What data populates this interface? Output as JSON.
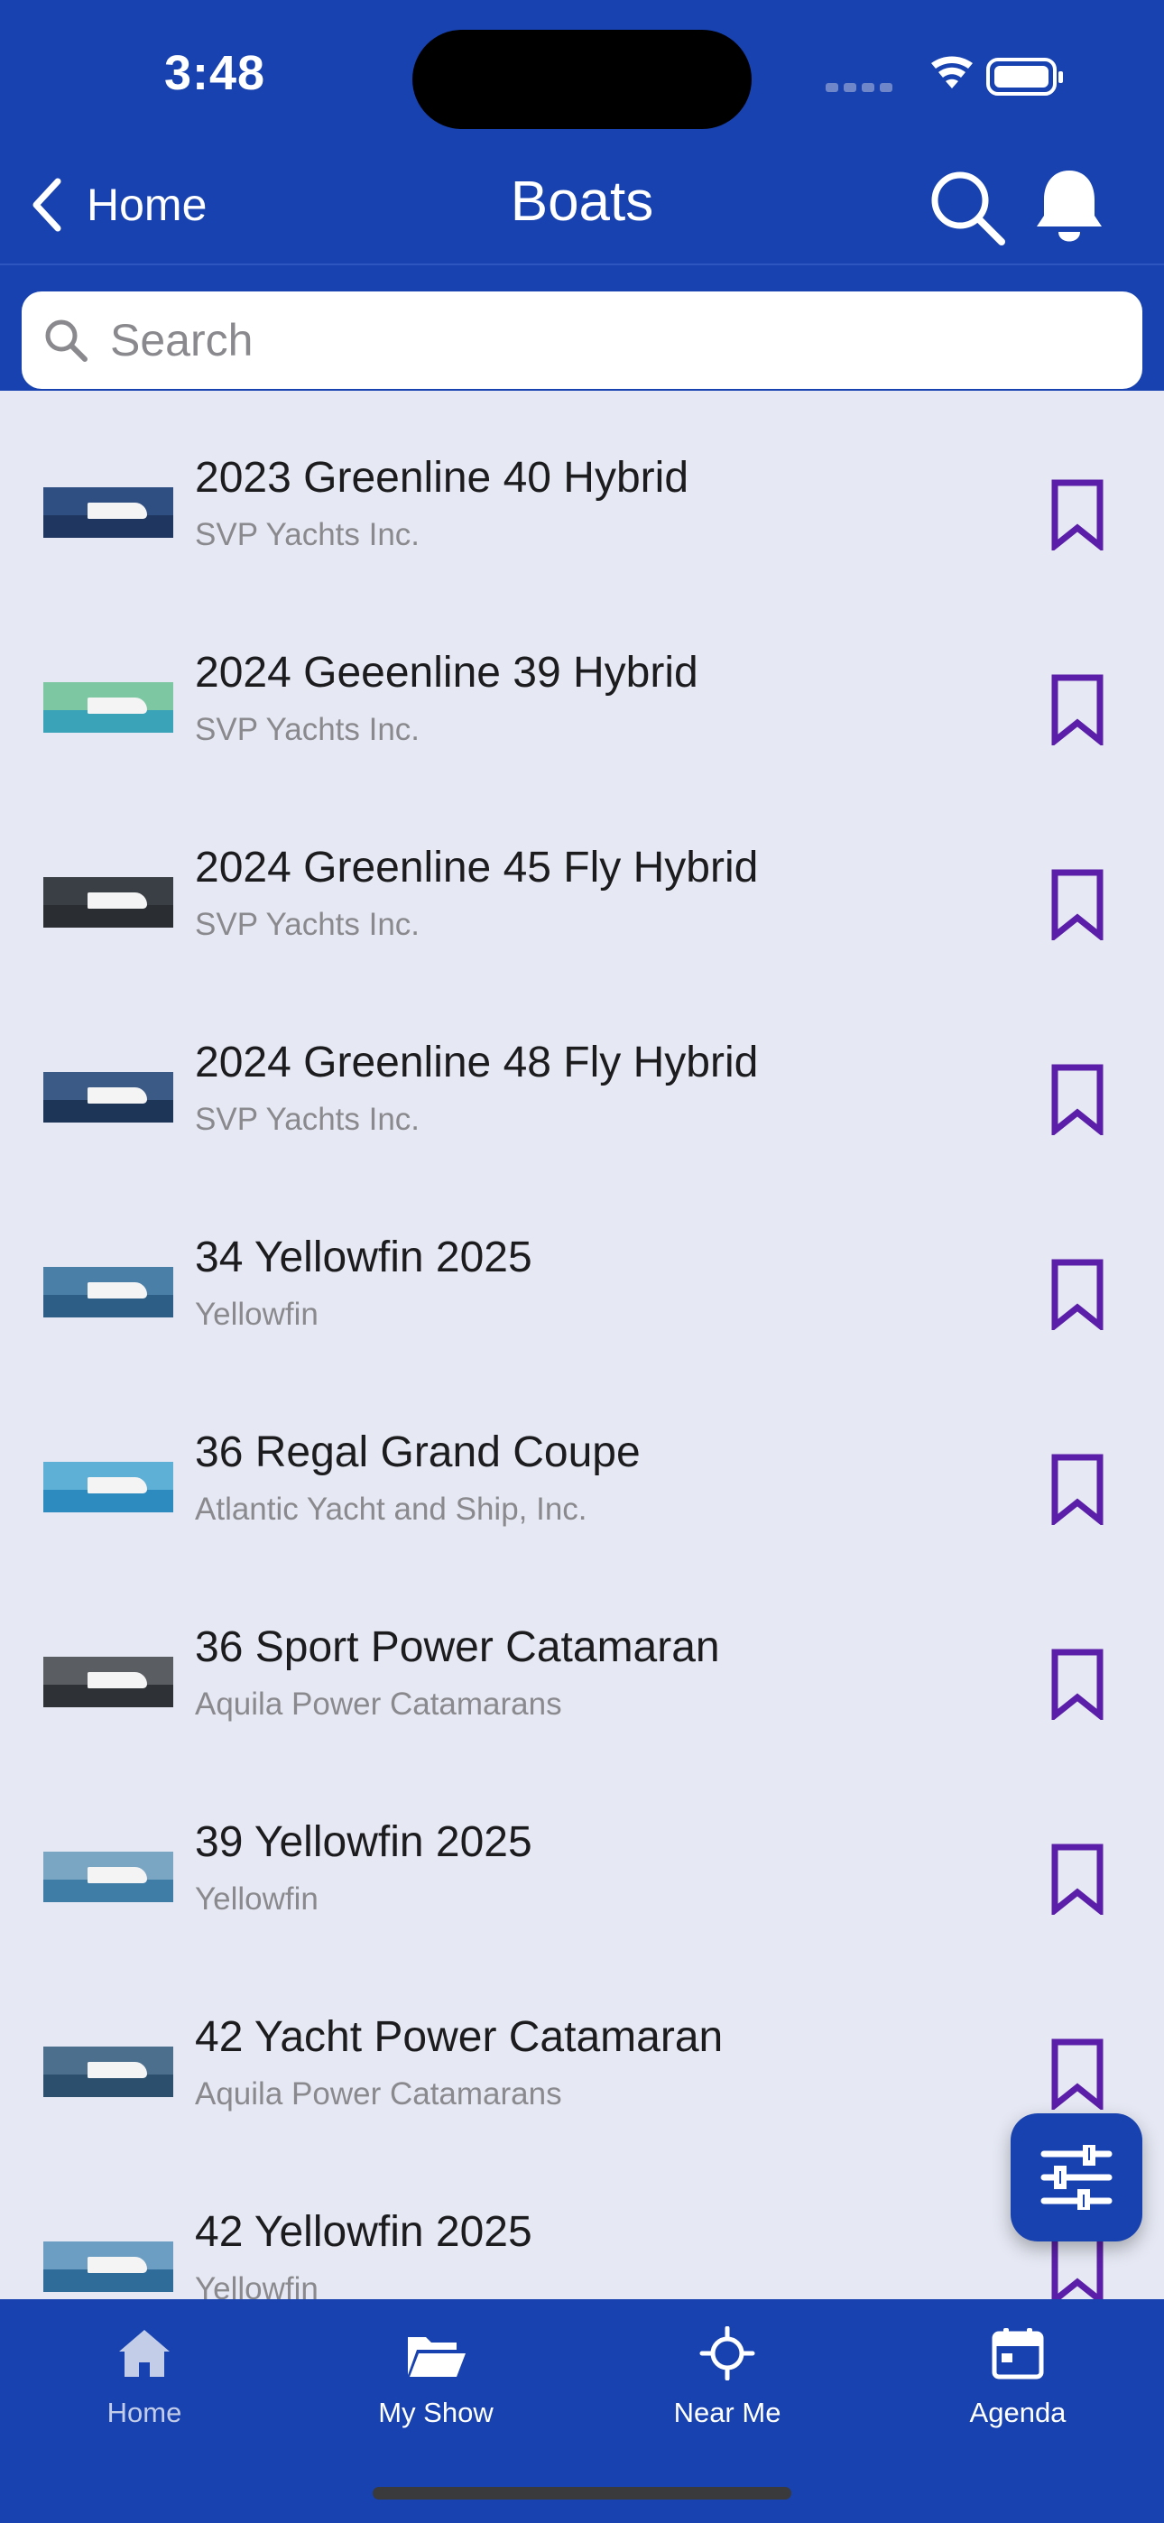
{
  "status_bar": {
    "time": "3:48"
  },
  "nav": {
    "back_label": "Home",
    "title": "Boats"
  },
  "search": {
    "placeholder": "Search",
    "value": ""
  },
  "colors": {
    "primary": "#1742b0",
    "bookmark": "#5b1ea8",
    "background": "#e6e9f4"
  },
  "boats": [
    {
      "title": "2023 Greenline 40 Hybrid",
      "subtitle": "SVP Yachts Inc.",
      "thumb_sky": "#2f4e82",
      "thumb_sea": "#1f3660"
    },
    {
      "title": "2024 Geeenline 39 Hybrid",
      "subtitle": "SVP Yachts Inc.",
      "thumb_sky": "#7ec7a3",
      "thumb_sea": "#3aa3b8"
    },
    {
      "title": "2024 Greenline 45 Fly Hybrid",
      "subtitle": "SVP Yachts Inc.",
      "thumb_sky": "#3a3f45",
      "thumb_sea": "#2a2e33"
    },
    {
      "title": "2024 Greenline 48 Fly Hybrid",
      "subtitle": "SVP Yachts Inc.",
      "thumb_sky": "#3c5a86",
      "thumb_sea": "#1d3556"
    },
    {
      "title": "34 Yellowfin 2025",
      "subtitle": "Yellowfin",
      "thumb_sky": "#4a7fa8",
      "thumb_sea": "#2c5e86"
    },
    {
      "title": "36 Regal Grand Coupe",
      "subtitle": "Atlantic Yacht and Ship, Inc.",
      "thumb_sky": "#5fb0d6",
      "thumb_sea": "#2d8bbf"
    },
    {
      "title": "36 Sport Power Catamaran",
      "subtitle": "Aquila Power Catamarans",
      "thumb_sky": "#5a5e63",
      "thumb_sea": "#2e3236"
    },
    {
      "title": "39 Yellowfin 2025",
      "subtitle": "Yellowfin",
      "thumb_sky": "#7aa6c4",
      "thumb_sea": "#3f7ca6"
    },
    {
      "title": "42 Yacht Power Catamaran",
      "subtitle": "Aquila Power Catamarans",
      "thumb_sky": "#4d6f8e",
      "thumb_sea": "#2d4f6e"
    },
    {
      "title": "42 Yellowfin 2025",
      "subtitle": "Yellowfin",
      "thumb_sky": "#6b9ec2",
      "thumb_sea": "#2f6c9a"
    }
  ],
  "tabs": [
    {
      "label": "Home",
      "icon": "home-icon",
      "active": false
    },
    {
      "label": "My Show",
      "icon": "folder-icon",
      "active": true
    },
    {
      "label": "Near Me",
      "icon": "crosshair-icon",
      "active": true
    },
    {
      "label": "Agenda",
      "icon": "calendar-icon",
      "active": true
    }
  ]
}
